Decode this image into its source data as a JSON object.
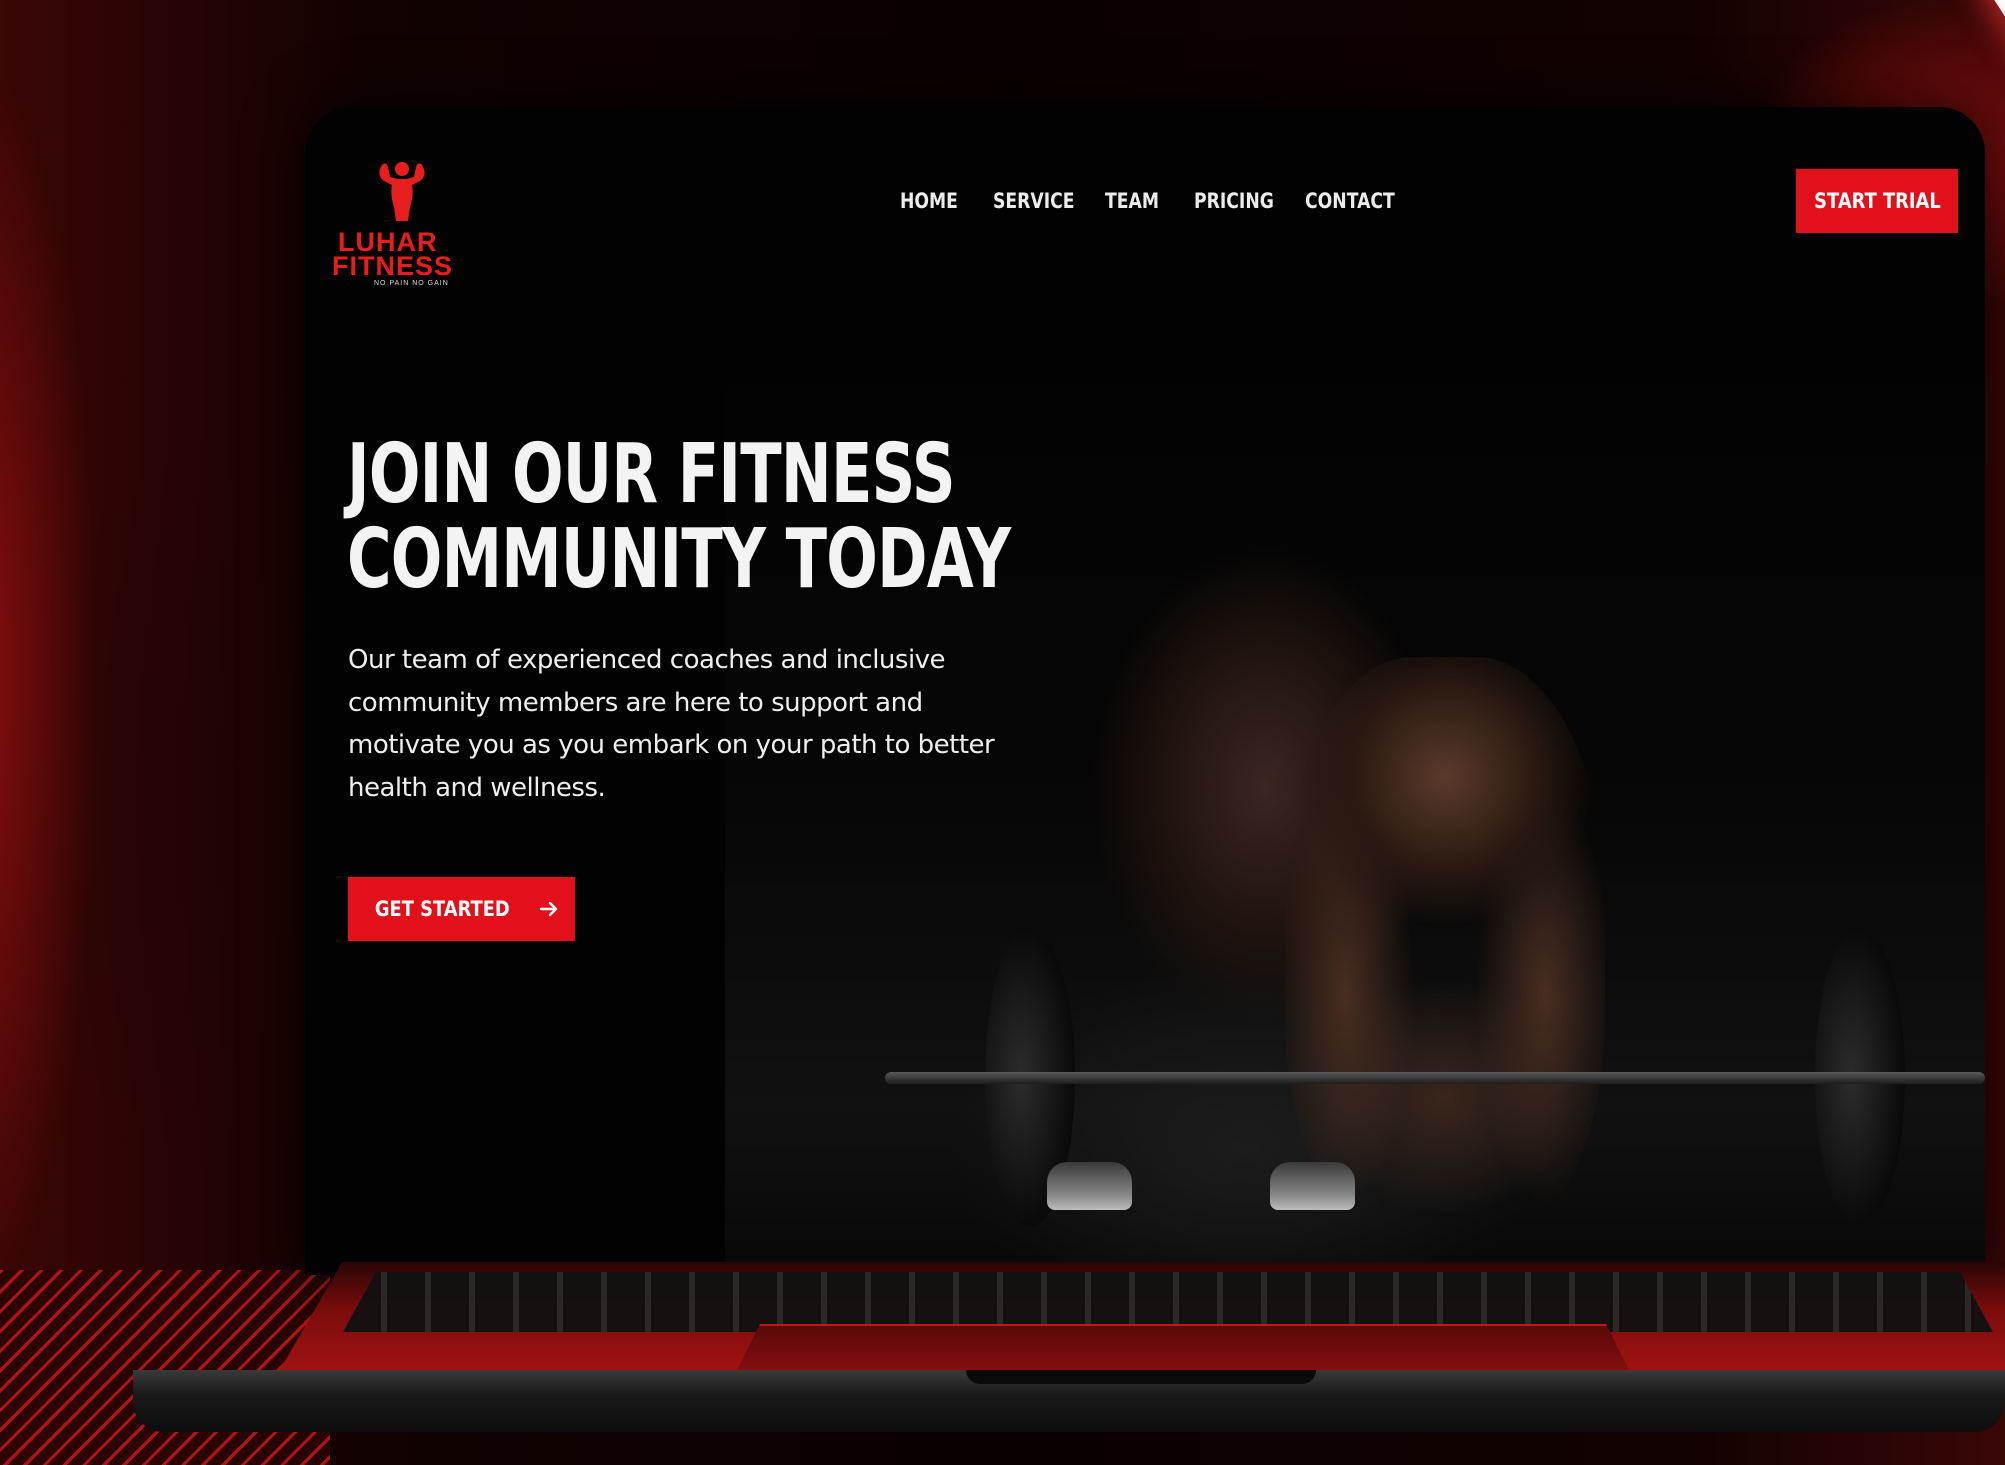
{
  "brand": {
    "name_line1": "LUHAR",
    "name_line2": "FITNESS",
    "tagline": "NO PAIN NO GAIN",
    "color": "#e61e1e"
  },
  "nav": {
    "items": [
      {
        "label": "HOME"
      },
      {
        "label": "SERVICE"
      },
      {
        "label": "TEAM"
      },
      {
        "label": "PRICING"
      },
      {
        "label": "CONTACT"
      }
    ],
    "cta_label": "START TRIAL"
  },
  "hero": {
    "title_line1": "JOIN OUR FITNESS",
    "title_line2": "COMMUNITY TODAY",
    "description": "Our team of experienced coaches and inclusive community members are here to support and motivate you as you embark on your path to better health and wellness.",
    "cta_label": "GET STARTED",
    "cta_icon": "arrow-right-icon"
  },
  "colors": {
    "accent": "#e2101a",
    "background": "#020202",
    "text": "#f3f3f3"
  }
}
